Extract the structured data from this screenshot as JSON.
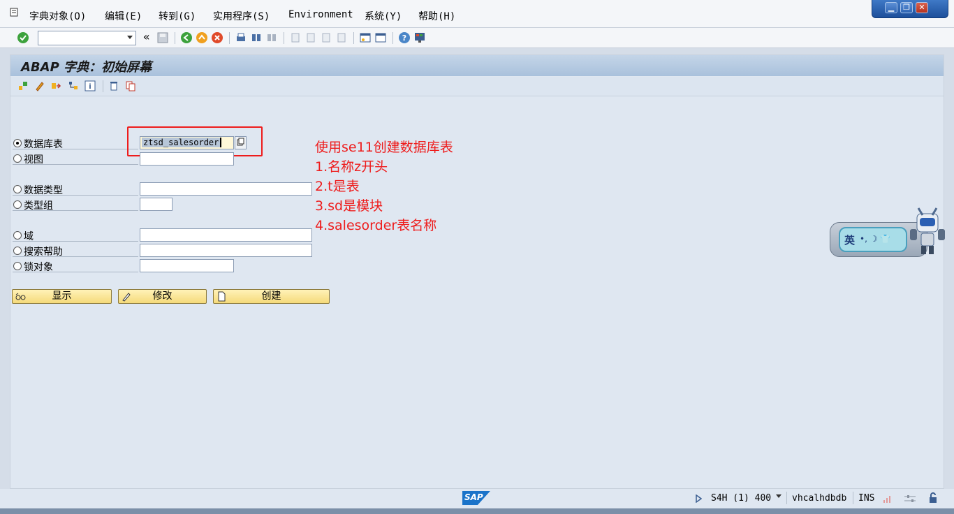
{
  "menu": {
    "items": [
      "字典对象(O)",
      "编辑(E)",
      "转到(G)",
      "实用程序(S)",
      "Environment",
      "系统(Y)",
      "帮助(H)"
    ]
  },
  "window_controls": {
    "minimize": "▁",
    "restore": "❐",
    "close": "✕"
  },
  "toolbar": {
    "command_field": ""
  },
  "page": {
    "title": "ABAP 字典：初始屏幕"
  },
  "form": {
    "fields": [
      {
        "label": "数据库表",
        "value": "ztsd_salesorder",
        "selected": true
      },
      {
        "label": "视图",
        "value": ""
      },
      {
        "label": "数据类型",
        "value": ""
      },
      {
        "label": "类型组",
        "value": ""
      },
      {
        "label": "域",
        "value": ""
      },
      {
        "label": "搜索帮助",
        "value": ""
      },
      {
        "label": "锁对象",
        "value": ""
      }
    ]
  },
  "buttons": {
    "display": "显示",
    "change": "修改",
    "create": "创建"
  },
  "annotation": {
    "lines": [
      "使用se11创建数据库表",
      "1.名称z开头",
      "2.t是表",
      "3.sd是模块",
      "4.salesorder表名称"
    ]
  },
  "ime_widget": {
    "text": "英",
    "symbols": "•, ☽ 👕"
  },
  "status": {
    "logo": "SAP",
    "system": "S4H (1) 400",
    "server": "vhcalhdbdb",
    "mode": "INS"
  },
  "colors": {
    "annotation": "#ee1c1c",
    "button_bg": "#f5da7a",
    "title_bar": "#a9c1dc",
    "sap_logo": "#1a73c9"
  }
}
